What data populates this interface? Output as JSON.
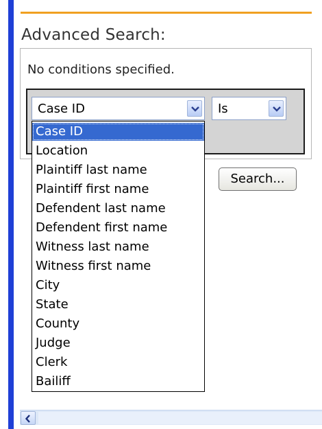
{
  "advanced_search": {
    "heading": "Advanced Search:",
    "no_conditions_text": "No conditions specified.",
    "field_select": {
      "value": "Case ID"
    },
    "operator_select": {
      "value": "Is"
    },
    "search_button": "Search...",
    "field_options": [
      "Case ID",
      "Location",
      "Plaintiff last name",
      "Plaintiff first name",
      "Defendent last name",
      "Defendent first name",
      "Witness last name",
      "Witness first name",
      "City",
      "State",
      "County",
      "Judge",
      "Clerk",
      "Bailiff"
    ],
    "selected_option_index": 0
  },
  "colors": {
    "left_bar": "#1f3fd6",
    "top_rule": "#f0a020",
    "selection": "#3569d0"
  },
  "icons": {
    "dropdown_arrow": "chevron-down-icon",
    "scroll_left": "chevron-left-icon"
  }
}
